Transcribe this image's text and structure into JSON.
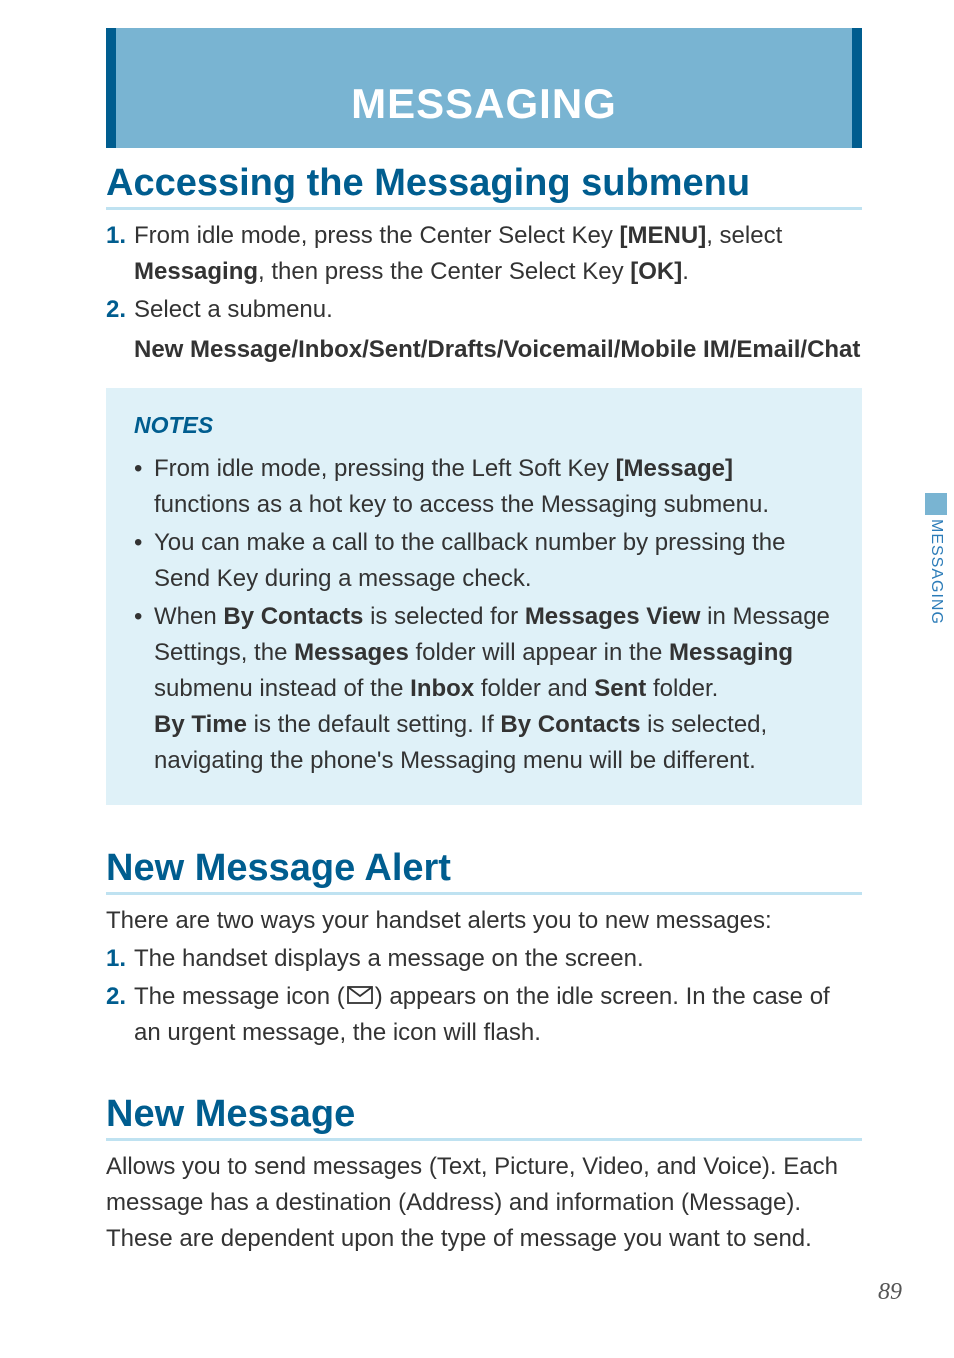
{
  "sidebar": {
    "tab_label": "MESSAGING"
  },
  "page_number": "89",
  "banner": {
    "title": "MESSAGING"
  },
  "sections": {
    "accessing": {
      "heading": "Accessing the Messaging submenu",
      "steps": {
        "s1": {
          "num": "1.",
          "t1": "From idle mode, press the Center Select Key ",
          "b1": "[MENU]",
          "t2": ", select ",
          "b2": "Messaging",
          "t3": ", then press the Center Select Key ",
          "b3": "[OK]",
          "t4": "."
        },
        "s2": {
          "num": "2.",
          "t1": "Select a submenu.",
          "sub_bold": "New Message/Inbox/Sent/Drafts/Voicemail/Mobile IM/Email/Chat"
        }
      },
      "notes": {
        "title": "NOTES",
        "n1": {
          "t1": "From idle mode, pressing the Left Soft Key ",
          "b1": "[Message]",
          "t2": " functions as a hot key to access the Messaging submenu."
        },
        "n2": {
          "t1": "You can make a call to the callback number by pressing the Send Key during a message check."
        },
        "n3": {
          "t1": "When ",
          "b1": "By Contacts",
          "t2": " is selected for ",
          "b2": "Messages View",
          "t3": " in Message Settings, the ",
          "b3": "Messages",
          "t4": " folder will appear in the ",
          "b4": "Messaging",
          "t5": " submenu instead of the ",
          "b5": "Inbox",
          "t6": " folder and ",
          "b6": "Sent",
          "t7": " folder.",
          "sub_t1a": "By Time",
          "sub_t1b": " is the default setting. If ",
          "sub_t1c": "By Contacts",
          "sub_t1d": " is selected, navigating the phone's Messaging menu will be different."
        }
      }
    },
    "alert": {
      "heading": "New Message Alert",
      "intro": "There are two ways your handset alerts you to new messages:",
      "steps": {
        "s1": {
          "num": "1.",
          "t1": "The handset displays a message on the screen."
        },
        "s2": {
          "num": "2.",
          "t1": "The message icon (",
          "t2": ") appears on the idle screen. In the case of an urgent message, the icon will flash."
        }
      }
    },
    "newmsg": {
      "heading": "New Message",
      "intro": "Allows you to send messages (Text, Picture, Video, and Voice). Each message has a destination (Address) and information (Message). These are dependent upon the type of message you want to send."
    }
  }
}
